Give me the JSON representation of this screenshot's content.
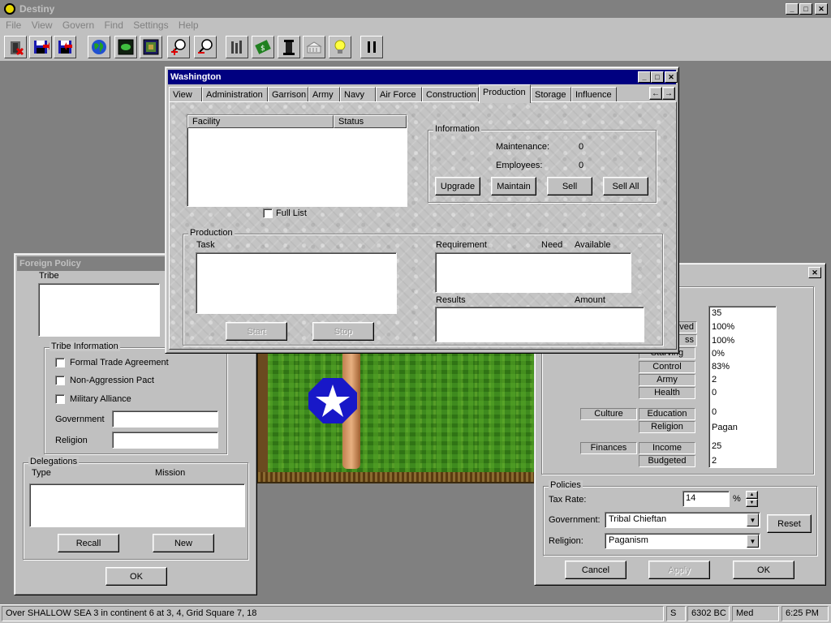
{
  "app": {
    "title": "Destiny",
    "menu": [
      "File",
      "View",
      "Govern",
      "Find",
      "Settings",
      "Help"
    ],
    "toolbar_icons": [
      "exit-icon",
      "save-icon",
      "load-icon",
      "globe-icon",
      "map-icon",
      "minimap-icon",
      "zoom-in-icon",
      "zoom-out-icon",
      "buildings-icon",
      "money-icon",
      "government-icon",
      "city-icon",
      "idea-icon",
      "pause-icon"
    ]
  },
  "washington": {
    "title": "Washington",
    "tabs": [
      "View",
      "Administration",
      "Garrison",
      "Army",
      "Navy",
      "Air Force",
      "Construction",
      "Production",
      "Storage",
      "Influence"
    ],
    "active_tab": "Production",
    "facility_table": {
      "columns": [
        "Facility",
        "Status"
      ]
    },
    "full_list_label": "Full List",
    "information": {
      "legend": "Information",
      "maintenance_label": "Maintenance:",
      "maintenance_value": "0",
      "employees_label": "Employees:",
      "employees_value": "0",
      "buttons": [
        "Upgrade",
        "Maintain",
        "Sell",
        "Sell All"
      ]
    },
    "production": {
      "legend": "Production",
      "task_label": "Task",
      "requirement_label": "Requirement",
      "need_label": "Need",
      "available_label": "Available",
      "results_label": "Results",
      "amount_label": "Amount",
      "start_label": "Start",
      "stop_label": "Stop"
    }
  },
  "foreign_policy": {
    "title": "Foreign Policy",
    "tribe_label": "Tribe",
    "tribe_info_legend": "Tribe Information",
    "checkboxes": [
      "Formal Trade Agreement",
      "Non-Aggression Pact",
      "Military Alliance"
    ],
    "government_label": "Government",
    "religion_label": "Religion",
    "delegations_legend": "Delegations",
    "type_label": "Type",
    "mission_label": "Mission",
    "recall_label": "Recall",
    "new_label": "New",
    "ok_label": "OK"
  },
  "city_stats": {
    "partial_labels": [
      "ved",
      "ss"
    ],
    "labels": [
      "Starving",
      "Control",
      "Army",
      "Health",
      "Education",
      "Religion",
      "Income",
      "Budgeted"
    ],
    "category_culture": "Culture",
    "category_finances": "Finances",
    "values": [
      "35",
      "100%",
      "100%",
      "0%",
      "83%",
      "2",
      "0",
      "0",
      "Pagan",
      "25",
      "2"
    ],
    "policies_legend": "Policies",
    "tax_rate_label": "Tax Rate:",
    "tax_rate_value": "14",
    "percent_sign": "%",
    "government_label": "Government:",
    "government_value": "Tribal Chieftan",
    "religion_label": "Religion:",
    "religion_value": "Paganism",
    "reset_label": "Reset",
    "cancel_label": "Cancel",
    "apply_label": "Apply",
    "ok_label": "OK"
  },
  "status_bar": {
    "message": "Over SHALLOW SEA 3 in continent 6 at 3, 4, Grid Square 7, 18",
    "direction": "S",
    "date": "6302 BC",
    "speed": "Med",
    "time": "6:25 PM"
  }
}
